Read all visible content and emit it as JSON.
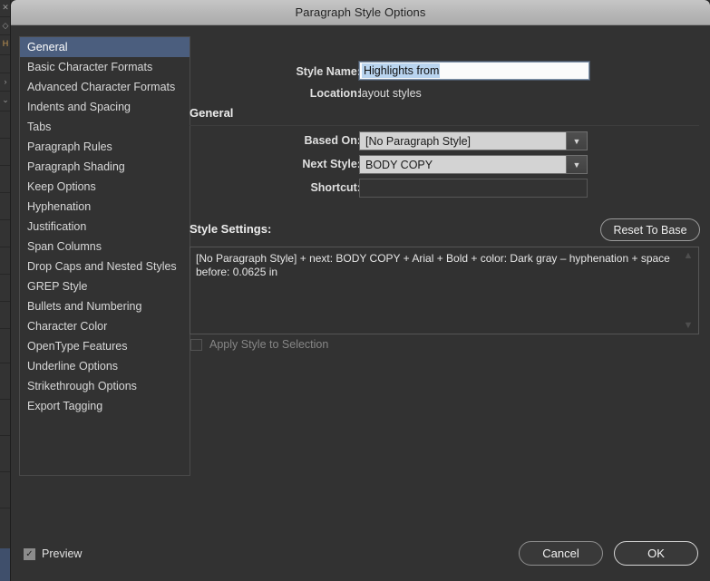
{
  "background": {
    "rail_icons": [
      "close-icon",
      "diamond-icon",
      "h-icon",
      "chevron-right-icon",
      "chevron-down-icon"
    ],
    "rail_accent_color": "#3f4f6b",
    "bottom_panel_icon": "folder-icon"
  },
  "dialog": {
    "title": "Paragraph Style Options"
  },
  "sidebar": {
    "items": [
      {
        "label": "General",
        "selected": true
      },
      {
        "label": "Basic Character Formats",
        "selected": false
      },
      {
        "label": "Advanced Character Formats",
        "selected": false
      },
      {
        "label": "Indents and Spacing",
        "selected": false
      },
      {
        "label": "Tabs",
        "selected": false
      },
      {
        "label": "Paragraph Rules",
        "selected": false
      },
      {
        "label": "Paragraph Shading",
        "selected": false
      },
      {
        "label": "Keep Options",
        "selected": false
      },
      {
        "label": "Hyphenation",
        "selected": false
      },
      {
        "label": "Justification",
        "selected": false
      },
      {
        "label": "Span Columns",
        "selected": false
      },
      {
        "label": "Drop Caps and Nested Styles",
        "selected": false
      },
      {
        "label": "GREP Style",
        "selected": false
      },
      {
        "label": "Bullets and Numbering",
        "selected": false
      },
      {
        "label": "Character Color",
        "selected": false
      },
      {
        "label": "OpenType Features",
        "selected": false
      },
      {
        "label": "Underline Options",
        "selected": false
      },
      {
        "label": "Strikethrough Options",
        "selected": false
      },
      {
        "label": "Export Tagging",
        "selected": false
      }
    ]
  },
  "main": {
    "style_name": {
      "label": "Style Name:",
      "value": "Highlights from",
      "selected": true
    },
    "location": {
      "label": "Location:",
      "value": "layout styles"
    },
    "section_header": "General",
    "based_on": {
      "label": "Based On:",
      "value": "[No Paragraph Style]",
      "arrow_icon": "chevron-down-icon"
    },
    "next_style": {
      "label": "Next Style:",
      "value": "BODY COPY",
      "arrow_icon": "chevron-down-icon"
    },
    "shortcut": {
      "label": "Shortcut:",
      "value": ""
    },
    "style_settings": {
      "label": "Style Settings:",
      "reset_button": "Reset To Base",
      "text": "[No Paragraph Style] + next: BODY COPY + Arial + Bold + color: Dark gray – hyphenation + space before: 0.0625 in",
      "scroll_up_icon": "chevron-up-icon",
      "scroll_down_icon": "chevron-down-icon"
    },
    "apply_style_to_selection": {
      "label": "Apply Style to Selection",
      "checked": false,
      "disabled": true
    }
  },
  "footer": {
    "preview": {
      "label": "Preview",
      "checked": true,
      "check_glyph": "✓"
    },
    "cancel_label": "Cancel",
    "ok_label": "OK"
  },
  "colors": {
    "dialog_bg": "#323232",
    "titlebar": "#b6b6b6",
    "selection_blue": "#4b5e7e",
    "text_selection": "#b9d4ef"
  }
}
